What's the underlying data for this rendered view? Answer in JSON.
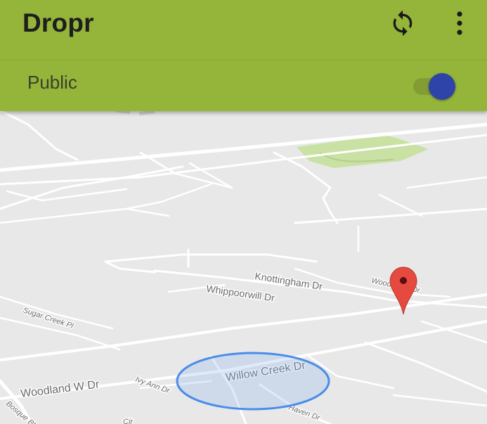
{
  "app": {
    "title": "Dropr",
    "accent_color": "#95b43a",
    "toggle_color": "#2f44a8"
  },
  "toolbar": {
    "refresh_icon": "refresh-icon",
    "menu_icon": "more-vert-icon"
  },
  "visibility": {
    "label": "Public",
    "enabled": true
  },
  "map": {
    "streets": {
      "knottingham": "Knottingham Dr",
      "whippoorwill": "Whippoorwill Dr",
      "willow_creek": "Willow Creek Dr",
      "woodland": "Woodland W Dr",
      "sugar_creek": "Sugar Creek Pl",
      "ivy_ann": "Ivy Ann Dr",
      "haven": "Haven Dr",
      "bosque": "Bosque Bl",
      "woodcreek": "Woodcreek Dr",
      "cir": "Cir"
    },
    "marker_icon": "map-pin-icon",
    "marker_color": "#e5493f",
    "area_color": "#4a8de8"
  }
}
